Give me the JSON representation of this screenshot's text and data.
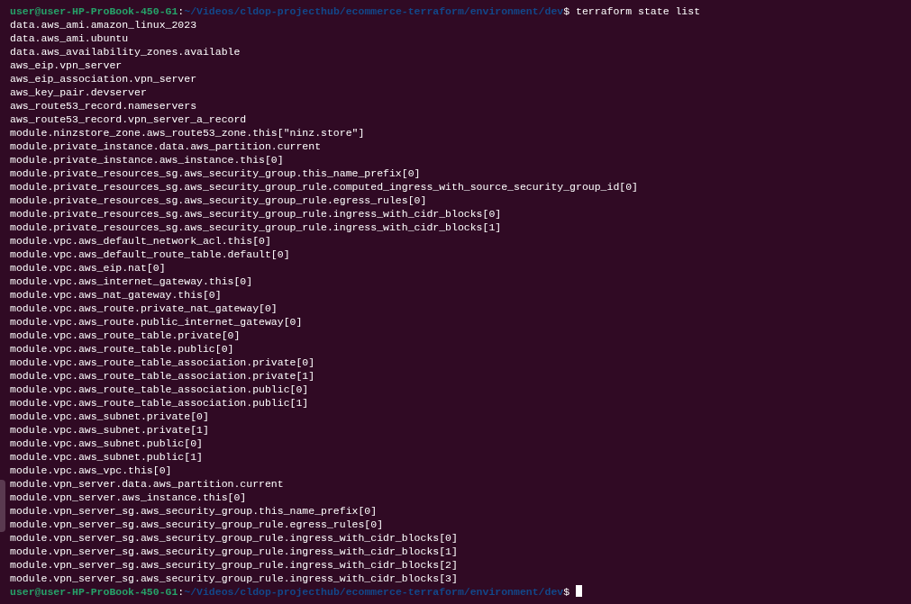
{
  "prompts": [
    {
      "user_host": "user@user-HP-ProBook-450-G1",
      "separator": ":",
      "path": "~/Videos/cldop-projecthub/ecommerce-terraform/environment/dev",
      "symbol": "$",
      "command": "terraform state list"
    }
  ],
  "output": [
    "data.aws_ami.amazon_linux_2023",
    "data.aws_ami.ubuntu",
    "data.aws_availability_zones.available",
    "aws_eip.vpn_server",
    "aws_eip_association.vpn_server",
    "aws_key_pair.devserver",
    "aws_route53_record.nameservers",
    "aws_route53_record.vpn_server_a_record",
    "module.ninzstore_zone.aws_route53_zone.this[\"ninz.store\"]",
    "module.private_instance.data.aws_partition.current",
    "module.private_instance.aws_instance.this[0]",
    "module.private_resources_sg.aws_security_group.this_name_prefix[0]",
    "module.private_resources_sg.aws_security_group_rule.computed_ingress_with_source_security_group_id[0]",
    "module.private_resources_sg.aws_security_group_rule.egress_rules[0]",
    "module.private_resources_sg.aws_security_group_rule.ingress_with_cidr_blocks[0]",
    "module.private_resources_sg.aws_security_group_rule.ingress_with_cidr_blocks[1]",
    "module.vpc.aws_default_network_acl.this[0]",
    "module.vpc.aws_default_route_table.default[0]",
    "module.vpc.aws_eip.nat[0]",
    "module.vpc.aws_internet_gateway.this[0]",
    "module.vpc.aws_nat_gateway.this[0]",
    "module.vpc.aws_route.private_nat_gateway[0]",
    "module.vpc.aws_route.public_internet_gateway[0]",
    "module.vpc.aws_route_table.private[0]",
    "module.vpc.aws_route_table.public[0]",
    "module.vpc.aws_route_table_association.private[0]",
    "module.vpc.aws_route_table_association.private[1]",
    "module.vpc.aws_route_table_association.public[0]",
    "module.vpc.aws_route_table_association.public[1]",
    "module.vpc.aws_subnet.private[0]",
    "module.vpc.aws_subnet.private[1]",
    "module.vpc.aws_subnet.public[0]",
    "module.vpc.aws_subnet.public[1]",
    "module.vpc.aws_vpc.this[0]",
    "module.vpn_server.data.aws_partition.current",
    "module.vpn_server.aws_instance.this[0]",
    "module.vpn_server_sg.aws_security_group.this_name_prefix[0]",
    "module.vpn_server_sg.aws_security_group_rule.egress_rules[0]",
    "module.vpn_server_sg.aws_security_group_rule.ingress_with_cidr_blocks[0]",
    "module.vpn_server_sg.aws_security_group_rule.ingress_with_cidr_blocks[1]",
    "module.vpn_server_sg.aws_security_group_rule.ingress_with_cidr_blocks[2]",
    "module.vpn_server_sg.aws_security_group_rule.ingress_with_cidr_blocks[3]"
  ],
  "final_prompt": {
    "user_host": "user@user-HP-ProBook-450-G1",
    "separator": ":",
    "path": "~/Videos/cldop-projecthub/ecommerce-terraform/environment/dev",
    "symbol": "$"
  }
}
